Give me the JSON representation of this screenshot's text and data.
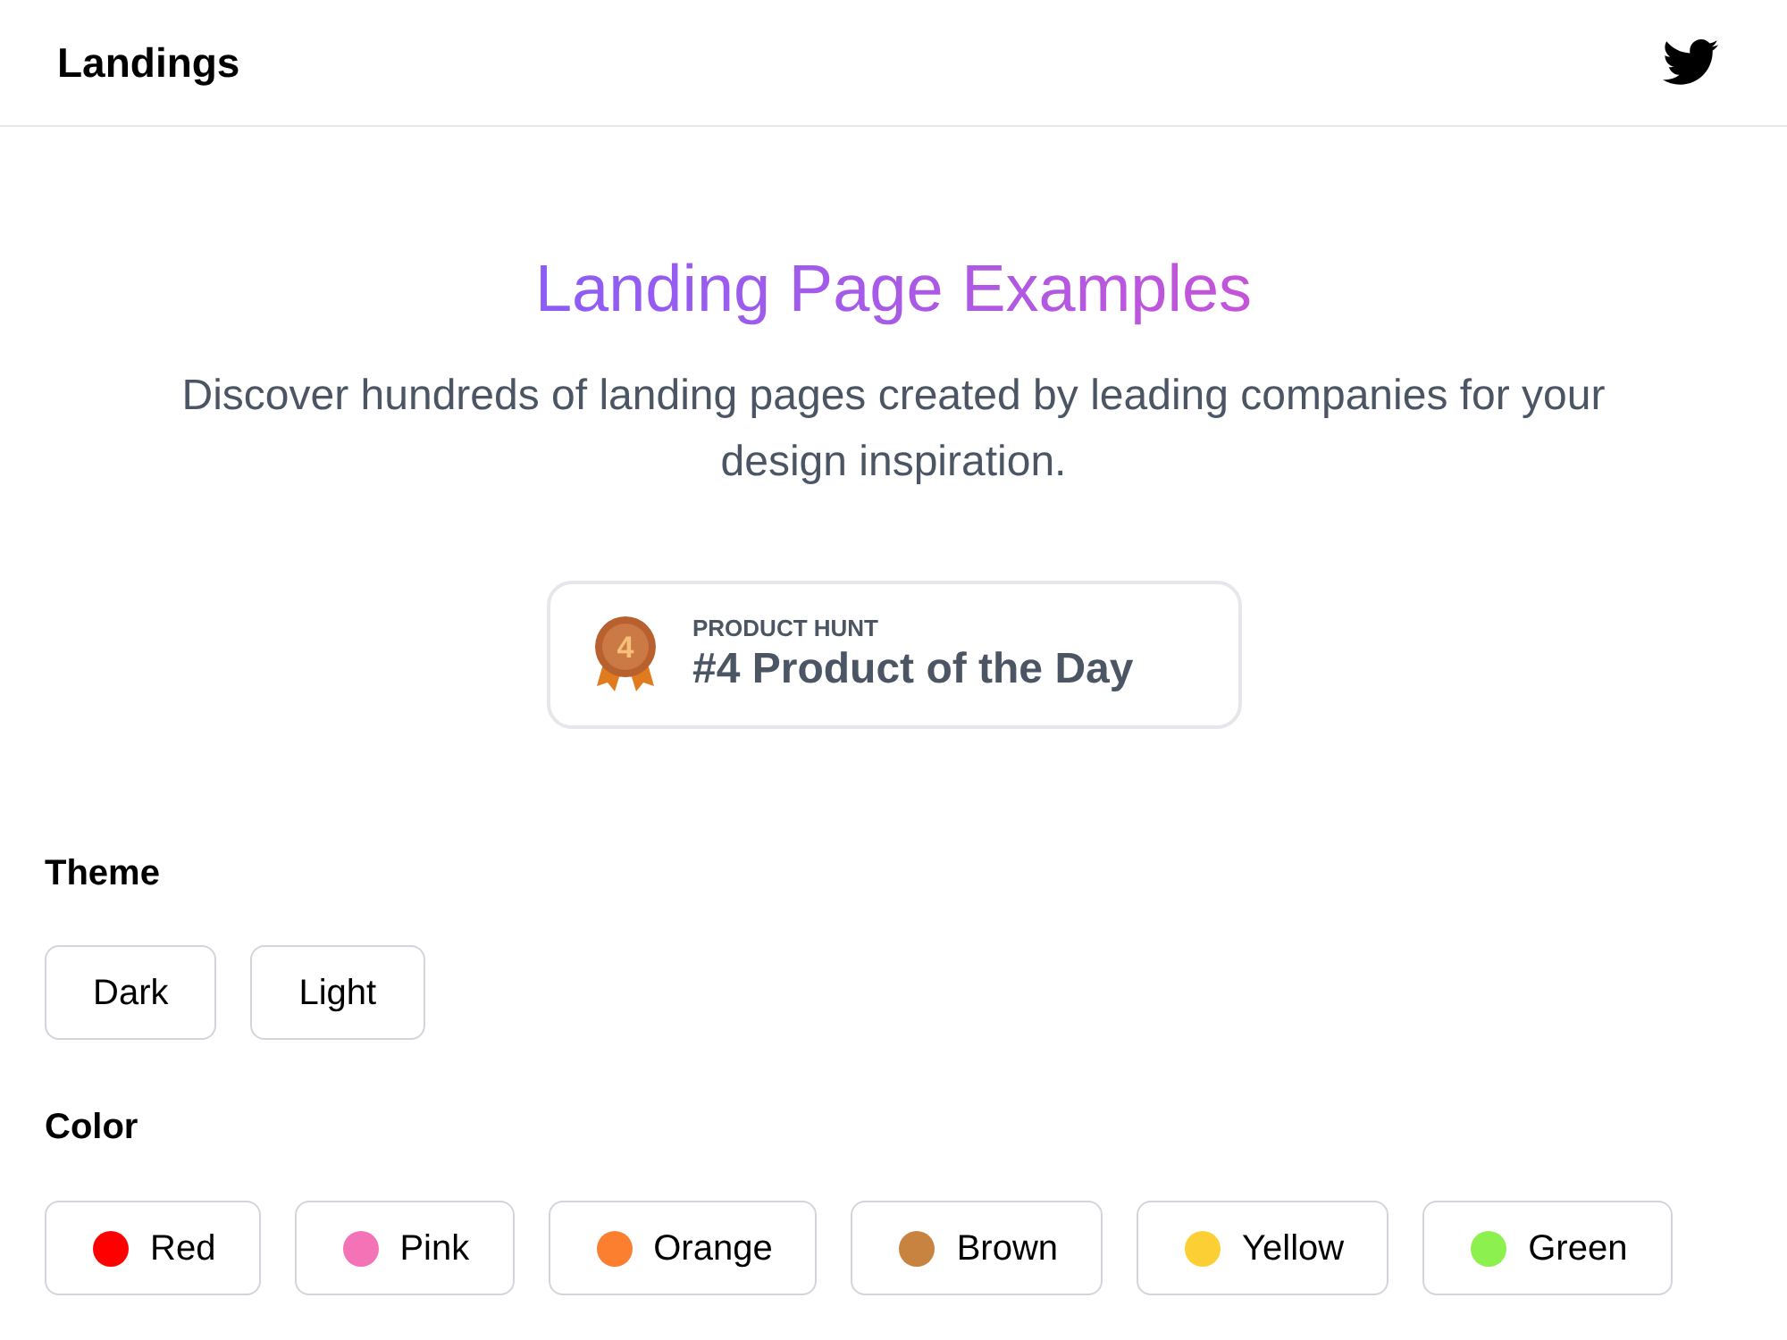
{
  "header": {
    "brand": "Landings"
  },
  "hero": {
    "title": "Landing Page Examples",
    "subtitle": "Discover hundreds of landing pages created by leading companies for your design inspiration."
  },
  "badge": {
    "rank": "4",
    "eyebrow": "PRODUCT HUNT",
    "text": "#4 Product of the Day"
  },
  "theme": {
    "label": "Theme",
    "options": [
      "Dark",
      "Light"
    ]
  },
  "color": {
    "label": "Color",
    "options": [
      {
        "label": "Red",
        "color": "#ff0000"
      },
      {
        "label": "Pink",
        "color": "#f472b6"
      },
      {
        "label": "Orange",
        "color": "#fb7f2e"
      },
      {
        "label": "Brown",
        "color": "#c98341"
      },
      {
        "label": "Yellow",
        "color": "#fcd034"
      },
      {
        "label": "Green",
        "color": "#8cf04f"
      }
    ]
  }
}
